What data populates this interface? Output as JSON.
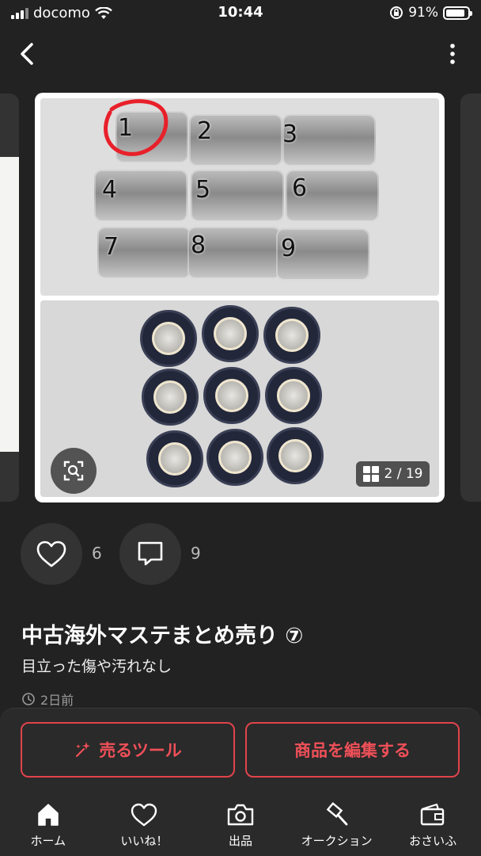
{
  "status_bar": {
    "carrier": "docomo",
    "time": "10:44",
    "battery": "91%"
  },
  "product": {
    "image_counter": "2 / 19",
    "tape_numbers": [
      "1",
      "2",
      "3",
      "4",
      "5",
      "6",
      "7",
      "8",
      "9"
    ],
    "likes": "6",
    "comments": "9",
    "title": "中古海外マステまとめ売り ⑦",
    "condition": "目立った傷や汚れなし",
    "posted": "2日前"
  },
  "actions": {
    "sell_tool": "売るツール",
    "edit_item": "商品を編集する"
  },
  "tabs": [
    {
      "label": "ホーム",
      "icon": "home-icon"
    },
    {
      "label": "いいね！",
      "icon": "heart-icon"
    },
    {
      "label": "出品",
      "icon": "camera-icon"
    },
    {
      "label": "オークション",
      "icon": "gavel-icon"
    },
    {
      "label": "おさいふ",
      "icon": "wallet-icon"
    }
  ],
  "colors": {
    "background": "#222222",
    "accent": "#e0434b",
    "circle_mark": "#e8202a"
  }
}
